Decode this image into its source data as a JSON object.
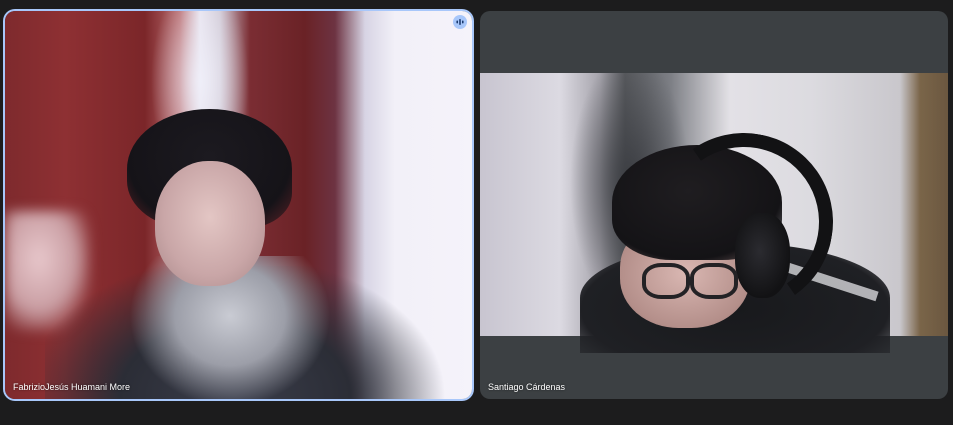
{
  "participants": [
    {
      "name": "FabrizioJesús Huamani More",
      "speaking": true,
      "icon": "audio-level-icon",
      "highlight_color": "#a8c7fa"
    },
    {
      "name": "Santiago Cárdenas",
      "speaking": false
    }
  ],
  "colors": {
    "background": "#1c1c1d",
    "tile_background": "#3c4043",
    "active_border": "#a8c7fa",
    "label_text": "#ffffff"
  }
}
